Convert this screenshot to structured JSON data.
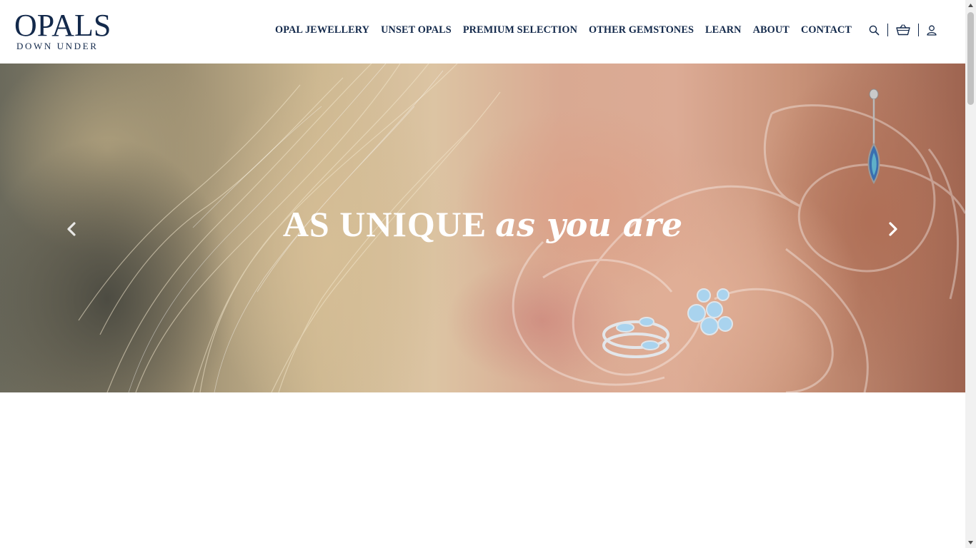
{
  "brand": {
    "logo_main": "OPALS",
    "logo_sub": "DOWN UNDER"
  },
  "nav": {
    "items": [
      {
        "label": "OPAL JEWELLERY"
      },
      {
        "label": "UNSET OPALS"
      },
      {
        "label": "PREMIUM SELECTION"
      },
      {
        "label": "OTHER GEMSTONES"
      },
      {
        "label": "LEARN"
      },
      {
        "label": "ABOUT"
      },
      {
        "label": "CONTACT"
      }
    ]
  },
  "tools": {
    "icons": [
      "search-icon",
      "basket-icon",
      "user-icon"
    ]
  },
  "hero": {
    "headline_caps": "AS UNIQUE",
    "headline_script": "as you are",
    "prev_icon": "chevron-left-icon",
    "next_icon": "chevron-right-icon"
  },
  "colors": {
    "brand_navy": "#13294b",
    "hero_text": "#ffffff",
    "page_bg": "#ffffff"
  }
}
